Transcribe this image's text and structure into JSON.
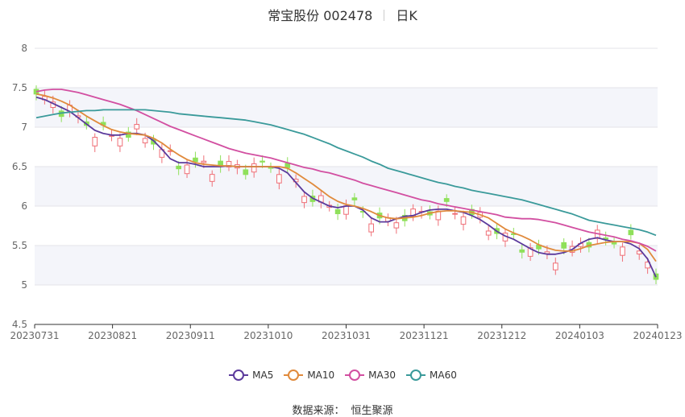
{
  "title": {
    "stock": "常宝股份 002478",
    "period": "日K"
  },
  "source": {
    "label": "数据来源：",
    "name": "恒生聚源"
  },
  "chart_data": {
    "type": "candlestick",
    "x_ticks": [
      "20230731",
      "20230821",
      "20230911",
      "20231010",
      "20231031",
      "20231121",
      "20231212",
      "20240103",
      "20240123"
    ],
    "y_ticks": [
      4.5,
      5,
      5.5,
      6,
      6.5,
      7,
      7.5,
      8
    ],
    "ylim": [
      4.5,
      8
    ],
    "up_color": "#ef6f77",
    "down_color": "#8fe05a",
    "grid": true,
    "legend": "bottom",
    "series": [
      {
        "name": "MA5",
        "color": "#5b3a9c",
        "values": [
          7.38,
          7.35,
          7.3,
          7.25,
          7.2,
          7.12,
          7.04,
          6.96,
          6.92,
          6.9,
          6.9,
          6.92,
          6.92,
          6.9,
          6.83,
          6.72,
          6.6,
          6.55,
          6.55,
          6.53,
          6.5,
          6.5,
          6.5,
          6.51,
          6.5,
          6.5,
          6.5,
          6.5,
          6.5,
          6.48,
          6.42,
          6.3,
          6.18,
          6.1,
          6.05,
          6.0,
          5.98,
          6.0,
          6.0,
          5.95,
          5.85,
          5.8,
          5.8,
          5.84,
          5.87,
          5.88,
          5.92,
          5.95,
          5.96,
          5.96,
          5.94,
          5.92,
          5.88,
          5.83,
          5.76,
          5.68,
          5.62,
          5.58,
          5.52,
          5.46,
          5.41,
          5.39,
          5.39,
          5.41,
          5.45,
          5.53,
          5.58,
          5.6,
          5.57,
          5.55,
          5.55,
          5.52,
          5.46,
          5.33,
          5.1
        ]
      },
      {
        "name": "MA10",
        "color": "#e08a3c",
        "values": [
          7.42,
          7.4,
          7.37,
          7.33,
          7.28,
          7.21,
          7.14,
          7.08,
          7.02,
          6.97,
          6.94,
          6.92,
          6.91,
          6.9,
          6.86,
          6.8,
          6.72,
          6.65,
          6.59,
          6.55,
          6.53,
          6.52,
          6.51,
          6.51,
          6.5,
          6.5,
          6.5,
          6.5,
          6.5,
          6.5,
          6.48,
          6.42,
          6.35,
          6.28,
          6.2,
          6.12,
          6.06,
          6.02,
          6.0,
          5.97,
          5.93,
          5.88,
          5.85,
          5.84,
          5.85,
          5.86,
          5.88,
          5.91,
          5.93,
          5.94,
          5.94,
          5.93,
          5.92,
          5.89,
          5.85,
          5.78,
          5.71,
          5.66,
          5.62,
          5.57,
          5.51,
          5.47,
          5.44,
          5.43,
          5.43,
          5.46,
          5.5,
          5.52,
          5.54,
          5.55,
          5.55,
          5.55,
          5.53,
          5.45,
          5.3
        ]
      },
      {
        "name": "MA30",
        "color": "#d24fa1",
        "values": [
          7.45,
          7.47,
          7.48,
          7.48,
          7.46,
          7.44,
          7.41,
          7.38,
          7.35,
          7.32,
          7.29,
          7.25,
          7.21,
          7.16,
          7.11,
          7.06,
          7.01,
          6.97,
          6.93,
          6.89,
          6.85,
          6.81,
          6.77,
          6.73,
          6.7,
          6.67,
          6.65,
          6.63,
          6.61,
          6.58,
          6.55,
          6.52,
          6.49,
          6.47,
          6.44,
          6.42,
          6.39,
          6.36,
          6.33,
          6.29,
          6.26,
          6.23,
          6.2,
          6.17,
          6.14,
          6.11,
          6.08,
          6.06,
          6.03,
          6.01,
          5.99,
          5.97,
          5.95,
          5.93,
          5.91,
          5.89,
          5.86,
          5.85,
          5.84,
          5.84,
          5.83,
          5.81,
          5.79,
          5.76,
          5.73,
          5.7,
          5.67,
          5.65,
          5.63,
          5.61,
          5.58,
          5.56,
          5.53,
          5.49,
          5.43
        ]
      },
      {
        "name": "MA60",
        "color": "#3a9a9a",
        "values": [
          7.12,
          7.14,
          7.16,
          7.18,
          7.19,
          7.2,
          7.21,
          7.21,
          7.22,
          7.22,
          7.22,
          7.22,
          7.22,
          7.22,
          7.21,
          7.2,
          7.19,
          7.17,
          7.16,
          7.15,
          7.14,
          7.13,
          7.12,
          7.11,
          7.1,
          7.09,
          7.07,
          7.05,
          7.03,
          7.0,
          6.97,
          6.94,
          6.91,
          6.87,
          6.83,
          6.79,
          6.74,
          6.7,
          6.66,
          6.62,
          6.57,
          6.53,
          6.48,
          6.45,
          6.42,
          6.39,
          6.36,
          6.33,
          6.3,
          6.28,
          6.25,
          6.23,
          6.2,
          6.18,
          6.16,
          6.14,
          6.12,
          6.1,
          6.08,
          6.05,
          6.02,
          5.99,
          5.96,
          5.93,
          5.9,
          5.86,
          5.82,
          5.8,
          5.78,
          5.76,
          5.74,
          5.72,
          5.7,
          5.67,
          5.63
        ]
      }
    ]
  }
}
